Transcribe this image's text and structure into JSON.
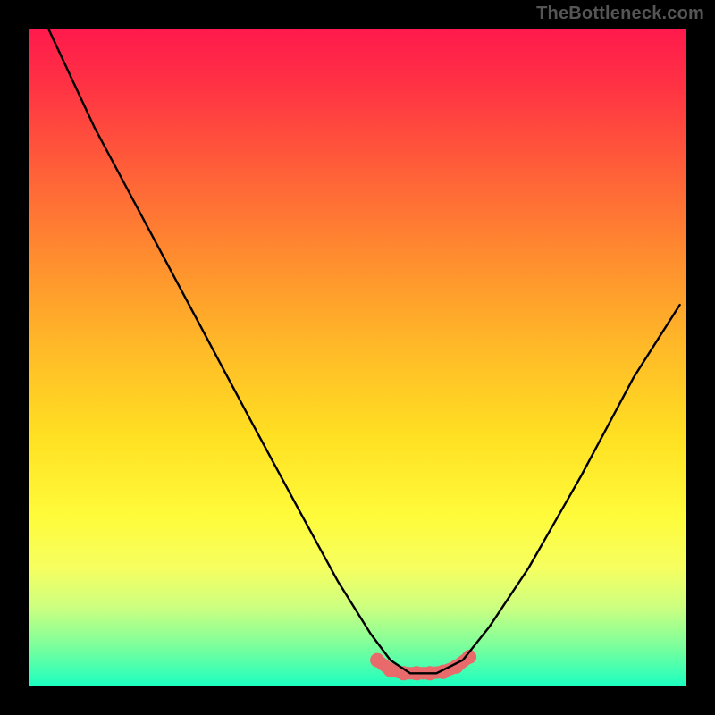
{
  "watermark": "TheBottleneck.com",
  "chart_data": {
    "type": "line",
    "title": "",
    "xlabel": "",
    "ylabel": "",
    "xlim": [
      0,
      100
    ],
    "ylim": [
      0,
      100
    ],
    "grid": false,
    "legend": false,
    "gradient_stops": [
      "#ff1a4d",
      "#ff5a3a",
      "#ffb828",
      "#fffb3a",
      "#7aff9c",
      "#1affc0"
    ],
    "series": [
      {
        "name": "black-curve",
        "color": "#000000",
        "x": [
          3,
          10,
          18,
          26,
          34,
          41,
          47,
          52,
          55,
          58,
          62,
          66,
          70,
          76,
          84,
          92,
          99
        ],
        "y": [
          100,
          85,
          70,
          55,
          40,
          27,
          16,
          8,
          4,
          2,
          2,
          4,
          9,
          18,
          32,
          47,
          58
        ]
      },
      {
        "name": "red-marker-band",
        "style": "marker",
        "color": "#e86a6a",
        "x": [
          53,
          55,
          57,
          59,
          61,
          63,
          65,
          67
        ],
        "y": [
          4,
          2.5,
          2,
          2,
          2,
          2.2,
          3,
          4.5
        ]
      }
    ]
  }
}
